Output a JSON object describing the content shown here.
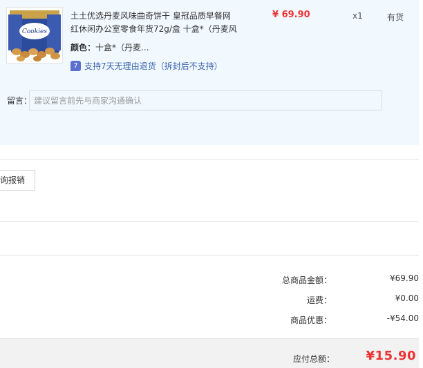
{
  "product": {
    "image_icon": "cookie-tin-photo",
    "image_text": "Cookies",
    "title_line1": "土土优选丹麦风味曲奇饼干 皇冠品质早餐网",
    "title_line2": "红休闲办公室零食年货72g/盒 十盒*（丹麦风",
    "price": "¥ 69.90",
    "quantity": "x1",
    "stock_status": "有货",
    "variant_key": "颜色：",
    "variant_value": "十盒*（丹麦...",
    "return_badge": "7",
    "return_policy": "支持7天无理由退货（拆封后不支持）"
  },
  "message": {
    "label": "留言：",
    "placeholder": "建议留言前先与商家沟通确认",
    "value": ""
  },
  "reimburse_button": "询报销",
  "summary": {
    "total_goods_label": "总商品金额：",
    "total_goods_value": "¥69.90",
    "shipping_label": "运费：",
    "shipping_value": "¥0.00",
    "discount_label": "商品优惠：",
    "discount_value": "-¥54.00"
  },
  "payment": {
    "label": "应付总额：",
    "total": "¥15.90"
  },
  "colors": {
    "card_background": "#f1f8fe",
    "price_red": "#ee3333",
    "link_blue": "#3c66b0",
    "badge_blue": "#5a6fd0"
  }
}
